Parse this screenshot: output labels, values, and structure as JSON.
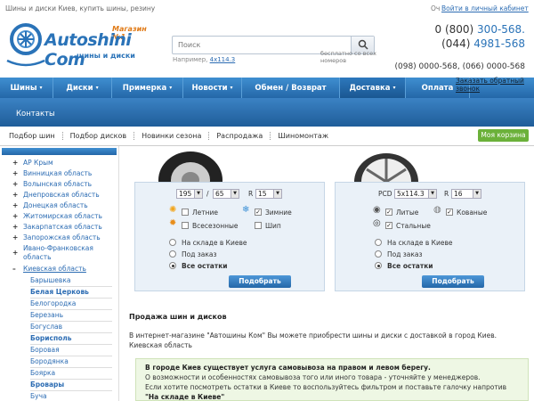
{
  "topbar": {
    "tagline": "Шины и диски Киев, купить шины, резину",
    "lang": "Оч",
    "login": "Войти в личный кабинет"
  },
  "logo": {
    "badge": "Магазин №1",
    "brand": "Autoshini Com",
    "subtitle": "шины и диски"
  },
  "search": {
    "placeholder": "Поиск",
    "hint_prefix": "Например,",
    "hint_example": "4x114.3"
  },
  "contacts": {
    "phone1_code": "0 (800) ",
    "phone1_num": "300-568.",
    "phone2_code": "(044) ",
    "phone2_num": "4981-568",
    "free_note": "бесплатно со всех номеров",
    "phone3": "(098) 0000-568, (066) 0000-568",
    "callback": "Заказать обратный звонок"
  },
  "nav": {
    "items": [
      {
        "label": "Шины",
        "caret": "▾"
      },
      {
        "label": "Диски",
        "caret": "▾"
      },
      {
        "label": "Примерка",
        "caret": "▾"
      },
      {
        "label": "Новости",
        "caret": "▾"
      },
      {
        "label": "Обмен / Возврат",
        "caret": ""
      },
      {
        "label": "Доставка",
        "caret": "▾"
      },
      {
        "label": "Оплата",
        "caret": ""
      }
    ]
  },
  "band": {
    "title": "Контакты"
  },
  "subnav": {
    "items": [
      "Подбор шин",
      "Подбор дисков",
      "Новинки сезона",
      "Распродажа",
      "Шиномонтаж"
    ],
    "cart": "Моя корзина"
  },
  "sidebar": {
    "regions": [
      {
        "sign": "+",
        "label": "АР Крым"
      },
      {
        "sign": "+",
        "label": "Винницкая область"
      },
      {
        "sign": "+",
        "label": "Волынская область"
      },
      {
        "sign": "+",
        "label": "Днепровская область"
      },
      {
        "sign": "+",
        "label": "Донецкая область"
      },
      {
        "sign": "+",
        "label": "Житомирская область"
      },
      {
        "sign": "+",
        "label": "Закарпатская область"
      },
      {
        "sign": "+",
        "label": "Запорожская область"
      },
      {
        "sign": "+",
        "label": "Ивано-Франковская область"
      },
      {
        "sign": "–",
        "label": "Киевская область"
      }
    ],
    "cities": [
      {
        "label": "Барышевка",
        "bold": false
      },
      {
        "label": "Белая Церковь",
        "bold": true
      },
      {
        "label": "Белогородка",
        "bold": false
      },
      {
        "label": "Березань",
        "bold": false
      },
      {
        "label": "Богуслав",
        "bold": false
      },
      {
        "label": "Борисполь",
        "bold": true
      },
      {
        "label": "Боровая",
        "bold": false
      },
      {
        "label": "Бородянка",
        "bold": false
      },
      {
        "label": "Боярка",
        "bold": false
      },
      {
        "label": "Бровары",
        "bold": true
      },
      {
        "label": "Буча",
        "bold": false
      }
    ]
  },
  "tire_filter": {
    "width": "195",
    "slash": "/",
    "profile": "65",
    "r_label": "R",
    "radius": "15",
    "season": [
      {
        "label": "Летние",
        "checked": false
      },
      {
        "label": "Зимние",
        "checked": true
      },
      {
        "label": "Всесезонные",
        "checked": false
      },
      {
        "label": "Шип",
        "checked": false
      }
    ],
    "stock": [
      {
        "label": "На складе в Киеве",
        "selected": false
      },
      {
        "label": "Под заказ",
        "selected": false
      },
      {
        "label": "Все остатки",
        "selected": true
      }
    ],
    "button": "Подобрать"
  },
  "disk_filter": {
    "pcd_label": "PCD",
    "pcd": "5x114.3",
    "r_label": "R",
    "radius": "16",
    "types": [
      {
        "label": "Литые",
        "checked": true
      },
      {
        "label": "Кованые",
        "checked": true
      },
      {
        "label": "Стальные",
        "checked": true
      }
    ],
    "stock": [
      {
        "label": "На складе в Киеве",
        "selected": false
      },
      {
        "label": "Под заказ",
        "selected": false
      },
      {
        "label": "Все остатки",
        "selected": true
      }
    ],
    "button": "Подобрать"
  },
  "content": {
    "title": "Продажа шин и дисков",
    "text": "В интернет-магазине \"Автошины Ком\" Вы можете приобрести шины и диски с доставкой в город Киев. Киевская область",
    "notice_bold": "В городе Киев существует услуга самовывоза на правом и левом берегу.",
    "notice_line2": "О возможности и особенностях самовывоза того или иного товара - уточняйте у менеджеров.",
    "notice_line3": "Если хотите посмотреть остатки в Киеве то воспользуйтесь фильтром и поставьте галочку напротив ",
    "notice_quote": "\"На складе в Киеве\""
  },
  "colors": {
    "brand_blue": "#2a73b8",
    "nav_blue": "#2467a8",
    "cart_green": "#6bb13a",
    "accent_orange": "#e07a16"
  }
}
